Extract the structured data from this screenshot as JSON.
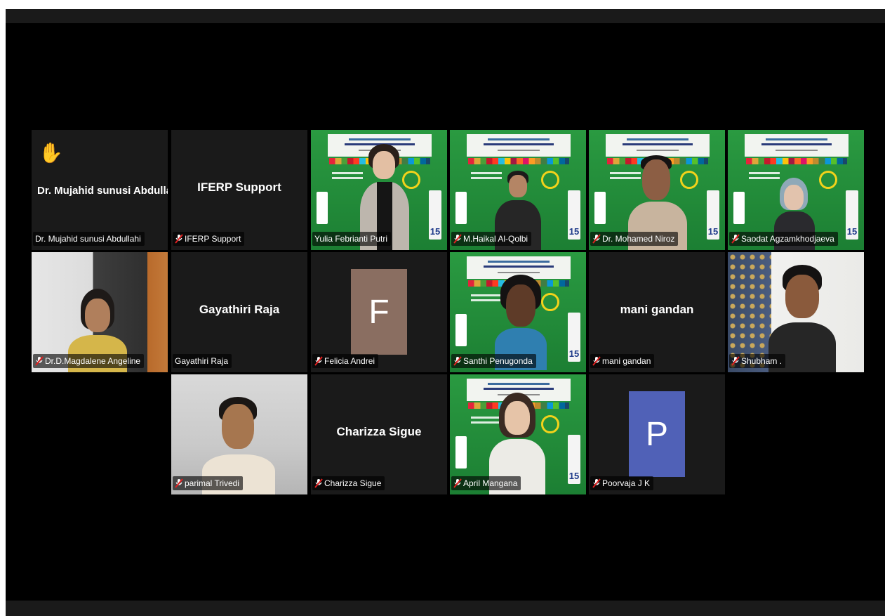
{
  "meeting": {
    "colors": {
      "background": "#000000",
      "tile": "#1a1a1a",
      "active_speaker_border": "#e4d96a",
      "avatar_f": "#8a6e61",
      "avatar_p": "#5061b7"
    }
  },
  "participants": [
    {
      "name": "Dr. Mujahid sunusi Abdullahi",
      "display": "Dr. Mujahid sunusi Abdullahi",
      "muted": false,
      "raised_hand": true,
      "video": false
    },
    {
      "name": "IFERP Support",
      "display": "IFERP Support",
      "muted": true,
      "video": false
    },
    {
      "name": "Yulia Febrianti Putri",
      "muted": false,
      "video": true,
      "active_speaker": true
    },
    {
      "name": "M.Haikal Al-Qolbi",
      "muted": true,
      "video": true
    },
    {
      "name": "Dr. Mohamed Niroz",
      "muted": true,
      "video": true
    },
    {
      "name": "Saodat Agzamkhodjaeva",
      "muted": true,
      "video": true
    },
    {
      "name": "Dr.D.Magdalene Angeline",
      "muted": true,
      "video": true
    },
    {
      "name": "Gayathiri Raja",
      "display": "Gayathiri Raja",
      "muted": false,
      "video": false
    },
    {
      "name": "Felicia Andrei",
      "avatar_letter": "F",
      "muted": true,
      "video": false
    },
    {
      "name": "Santhi Penugonda",
      "muted": true,
      "video": true
    },
    {
      "name": "mani gandan",
      "display": "mani gandan",
      "muted": true,
      "video": false
    },
    {
      "name": "Shubham .",
      "muted": true,
      "video": true
    },
    {
      "name": "parimal Trivedi",
      "muted": true,
      "video": true
    },
    {
      "name": "Charizza Sigue",
      "display": "Charizza Sigue",
      "muted": true,
      "video": false
    },
    {
      "name": "April Mangana",
      "muted": true,
      "video": true
    },
    {
      "name": "Poorvaja J K",
      "avatar_letter": "P",
      "muted": true,
      "video": false
    }
  ],
  "backdrop": {
    "badge_number": "15"
  },
  "icons": {
    "raised_hand": "raised-hand-icon",
    "muted_mic": "muted-mic-icon"
  }
}
